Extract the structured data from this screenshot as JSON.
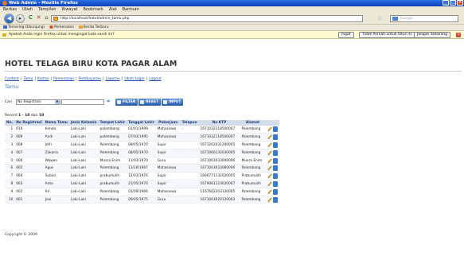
{
  "window": {
    "title": "Web Admin - Mozilla Firefox"
  },
  "menubar": [
    "Berkas",
    "Ubah",
    "Tampilan",
    "Riwayat",
    "Bookmark",
    "Alat",
    "Bantuan"
  ],
  "address": {
    "url": "http://localhost/hotel/admin_tamu.php",
    "search_placeholder": "Google"
  },
  "bookmarks": [
    {
      "label": "Tersering Dikunjungi",
      "color": "#3a6ad0"
    },
    {
      "label": "Perkenalan",
      "color": "#e05020"
    },
    {
      "label": "Berita Terbaru",
      "color": "#e8a03a"
    }
  ],
  "notification": {
    "text": "Apakah Anda ingin Firefox untuk mengingat kata sandi ini?",
    "buttons": [
      "Ingat",
      "Tidak Pernah untuk Situs ini",
      "Jangan Sekarang"
    ]
  },
  "site": {
    "title": "HOTEL TELAGA BIRU KOTA PAGAR ALAM",
    "menu": [
      "Content",
      "Tamu",
      "Kamar",
      "Pemesanan",
      "Pembayaran",
      "Laporan",
      "Ubah Login",
      "Logout"
    ],
    "section": "Tamu"
  },
  "search": {
    "label": "Cari",
    "select_value": "No Registrasi",
    "value": "",
    "filter_label": "FILTER",
    "reset_label": "RESET",
    "input_label": "INPUT"
  },
  "record": {
    "prefix": "Record",
    "range": "1 - 10",
    "of": "dari",
    "total": "10"
  },
  "table": {
    "headers": [
      "No.",
      "No Registrasi",
      "Nama Tamu",
      "Jenis Kelamin",
      "Tempat Lahir",
      "Tanggal Lahir",
      "Pekerjaan",
      "Telepon",
      "No KTP",
      "Alamat",
      ""
    ],
    "rows": [
      [
        "1",
        "010",
        "hendo",
        "Laki-Laki",
        "palembang",
        "01/01/1999",
        "Mahasiswa",
        "-",
        "1671032118500007",
        "Palembang"
      ],
      [
        "2",
        "009",
        "Andi",
        "Laki-Laki",
        "palembang",
        "07/03/1995",
        "Mahasiswa",
        "",
        "1671032118500007",
        "Palembang"
      ],
      [
        "3",
        "008",
        "Jefri",
        "Laki-Laki",
        "Palembang",
        "08/05/1970",
        "Supir",
        "",
        "1671202031200005",
        "Palembang"
      ],
      [
        "4",
        "007",
        "Zakaria",
        "Laki-Laki",
        "Palembang",
        "08/05/1970",
        "Supir",
        "",
        "1671060132030005",
        "Palembang"
      ],
      [
        "5",
        "006",
        "Wawan",
        "Laki-Laki",
        "Muara Enim",
        "11/03/1970",
        "Guru",
        "",
        "1671003033040006",
        "Muara Enim"
      ],
      [
        "6",
        "005",
        "Agus",
        "Laki-Laki",
        "Palembang",
        "13/10/1967",
        "Mahasiswa",
        "",
        "1671003033060006",
        "Palembang"
      ],
      [
        "7",
        "004",
        "Subari",
        "Laki-Laki",
        "prabumulih",
        "12/01/1976",
        "Supir",
        "",
        "1666771132020005",
        "Prabumulih"
      ],
      [
        "8",
        "003",
        "Anto",
        "Laki-Laki",
        "prabumulih",
        "21/05/1970",
        "Supir",
        "",
        "1679061123020007",
        "Prabumulih"
      ],
      [
        "9",
        "002",
        "Ari",
        "Laki-Laki",
        "Palembang",
        "01/09/1966",
        "Mahasiswa",
        "",
        "1167602203120005",
        "Palembang"
      ],
      [
        "10",
        "001",
        "Joni",
        "Laki-Laki",
        "Palembang",
        "09/05/1975",
        "Guru",
        "",
        "1671003020120003",
        "Palembang"
      ]
    ]
  },
  "footer": "Copyright © 2009"
}
